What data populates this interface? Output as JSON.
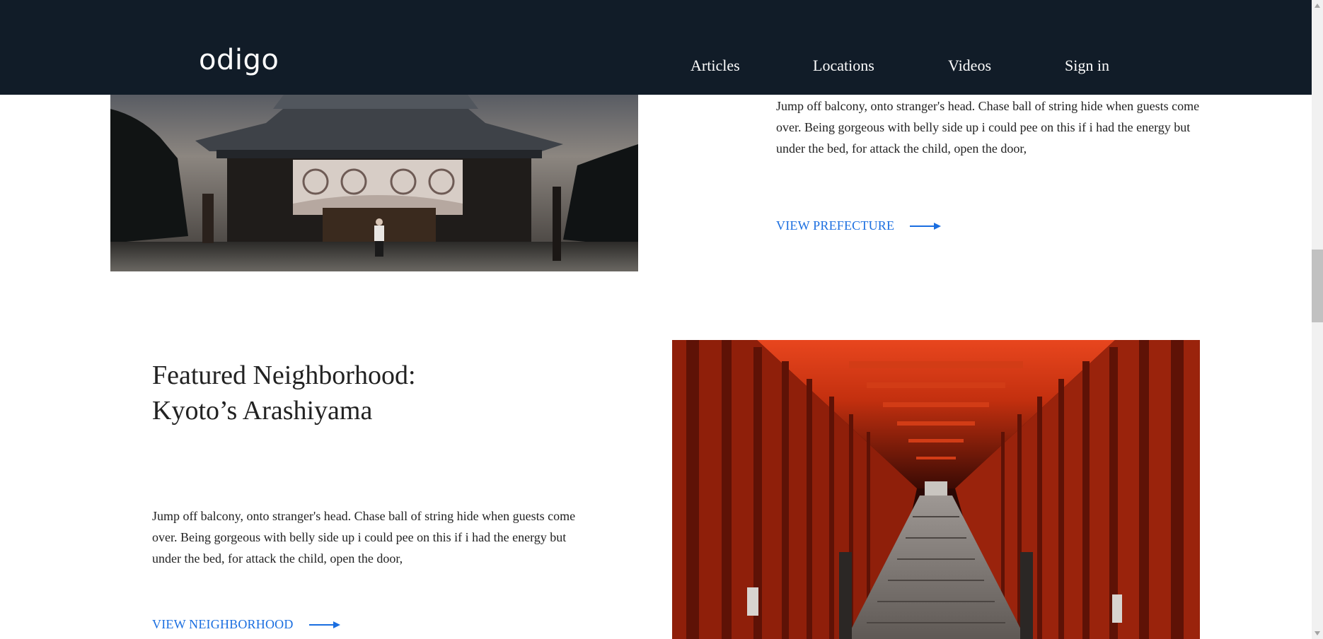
{
  "header": {
    "logo": "odigo",
    "nav": [
      "Articles",
      "Locations",
      "Videos",
      "Sign in"
    ]
  },
  "prefecture": {
    "description": "Jump off balcony, onto stranger's head. Chase ball of string hide when guests come over. Being gorgeous with belly side up i could pee on this if i had the energy but under the bed, for attack the child, open the door,",
    "cta": "VIEW PREFECTURE",
    "image_icon": "temple-photo"
  },
  "neighborhood": {
    "title_line1": "Featured Neighborhood:",
    "title_line2": "Kyoto’s Arashiyama",
    "description": "Jump off balcony, onto stranger's head. Chase ball of string hide when guests come over. Being gorgeous with belly side up i could pee on this if i had the energy but under the bed, for attack the child, open the door,",
    "cta": "VIEW NEIGHBORHOOD",
    "image_icon": "torii-gates-photo"
  },
  "colors": {
    "header_bg": "#111c28",
    "link_blue": "#1a6ee0",
    "text": "#222222"
  },
  "icons": [
    "arrow-right-icon",
    "scroll-up-icon",
    "scroll-down-icon"
  ]
}
